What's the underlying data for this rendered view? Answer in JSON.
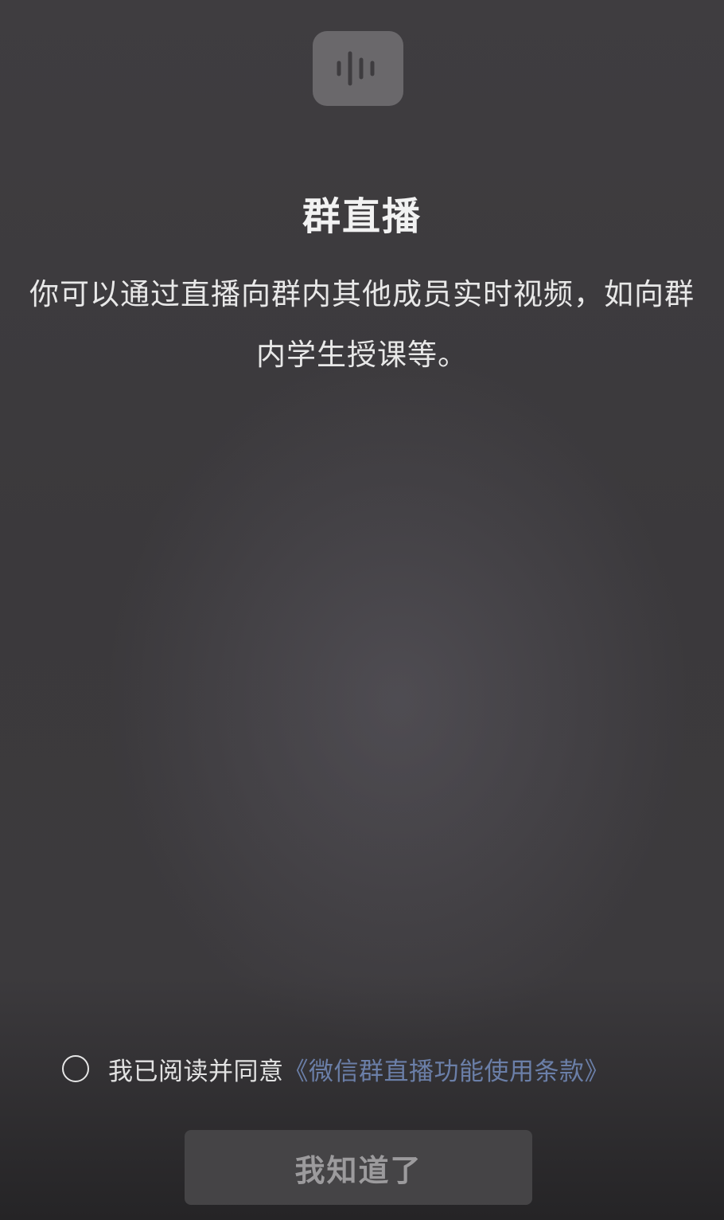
{
  "header": {
    "icon": "voice-wave-icon",
    "title": "群直播"
  },
  "main": {
    "description": "你可以通过直播向群内其他成员实时视频，如向群内学生授课等。"
  },
  "agreement": {
    "checked": false,
    "prefix": "我已阅读并同意",
    "link_text": "《微信群直播功能使用条款》"
  },
  "actions": {
    "confirm_label": "我知道了"
  },
  "colors": {
    "background": "#3c3a3d",
    "link": "#6b7fa8",
    "button_bg": "#454446",
    "button_text": "#9c9b9d"
  }
}
